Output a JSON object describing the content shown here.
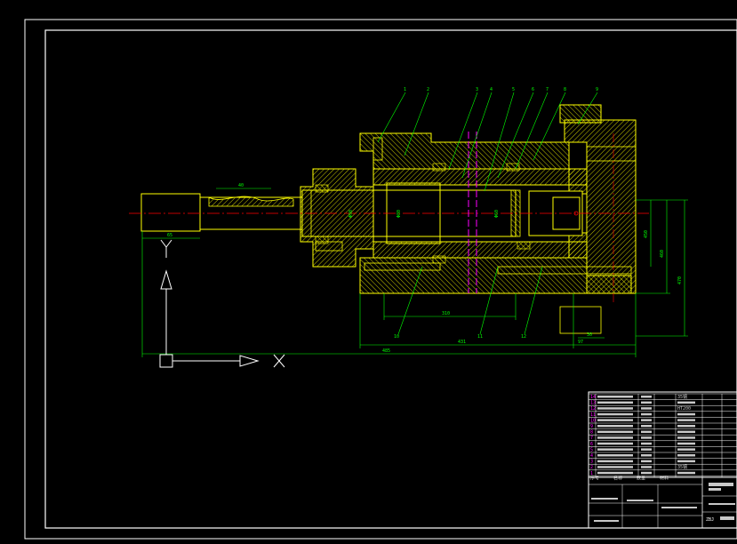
{
  "colors": {
    "background": "#000000",
    "border": "#ffffff",
    "outline": "#ffff00",
    "hatch": "#ffff00",
    "centerline": "#ff0000",
    "section": "#ff00ff",
    "leader": "#00ff00",
    "dimension": "#00ff00",
    "axis": "#ffffff",
    "title_block": "#ffffff",
    "title_text": "#c8c8c8"
  },
  "drawing": {
    "axis_labels": {
      "x": "X",
      "y": "Y"
    },
    "dimensions": {
      "overall_length": "485",
      "bore_length": "431",
      "right_section": "97",
      "stroke": "310",
      "small_right": "30",
      "vertical_1": "470",
      "vertical_2": "460",
      "vertical_3": "450",
      "diameter_1": "Φ90",
      "diameter_2": "Φ80",
      "diameter_3": "Φ60",
      "shaft_1": "40",
      "shaft_2": "65"
    },
    "part_numbers": [
      "1",
      "2",
      "3",
      "4",
      "5",
      "6",
      "7",
      "8",
      "9",
      "10",
      "11",
      "12",
      "13",
      "14"
    ]
  },
  "title_block": {
    "parts_list": [
      {
        "num": "14",
        "material": "35钢"
      },
      {
        "num": "13",
        "material": ""
      },
      {
        "num": "12",
        "material": "HT200"
      },
      {
        "num": "11",
        "material": ""
      },
      {
        "num": "10",
        "material": ""
      },
      {
        "num": "9",
        "material": ""
      },
      {
        "num": "8",
        "material": ""
      },
      {
        "num": "7",
        "material": ""
      },
      {
        "num": "6",
        "material": ""
      },
      {
        "num": "5",
        "material": ""
      },
      {
        "num": "4",
        "material": ""
      },
      {
        "num": "3",
        "material": ""
      },
      {
        "num": "2",
        "material": "35钢"
      },
      {
        "num": "1",
        "material": ""
      }
    ],
    "header_labels": [
      "序号",
      "名称",
      "数量",
      "材料"
    ],
    "drawing_code": "ZBJ"
  }
}
